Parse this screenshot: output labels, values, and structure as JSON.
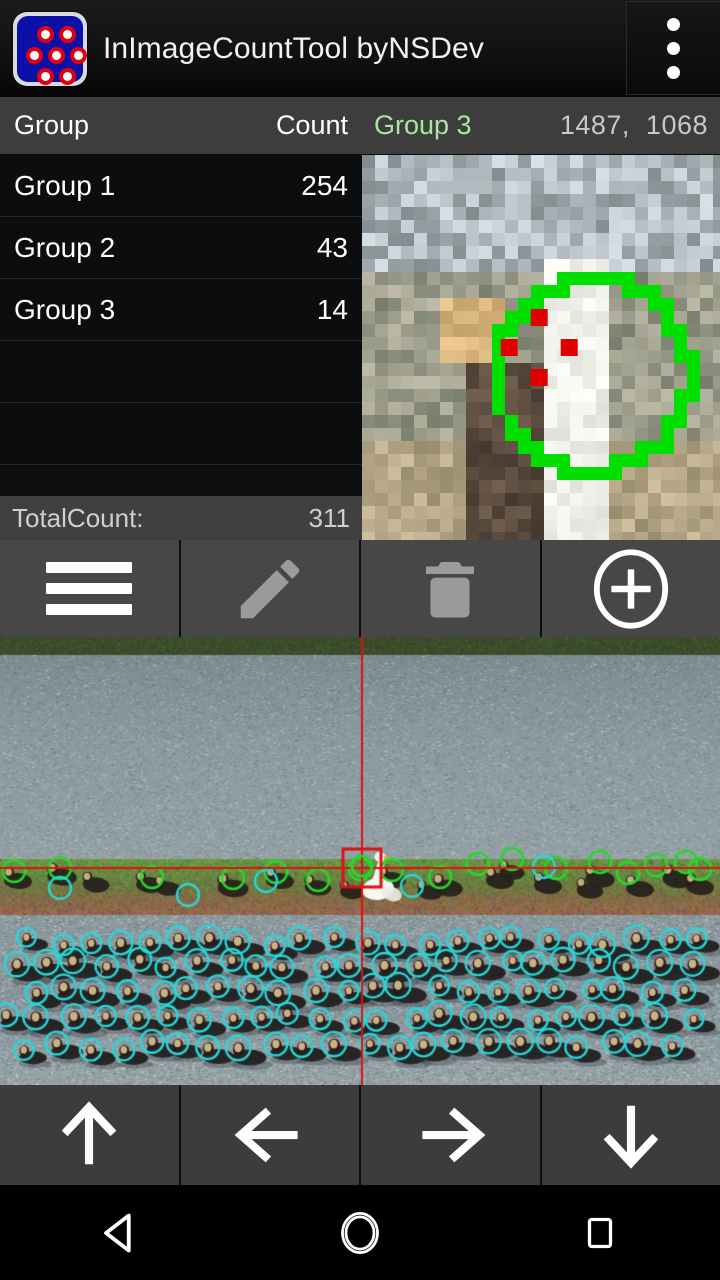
{
  "titlebar": {
    "app_title": "InImageCountTool byNSDev",
    "icon_name": "app-logo-icon",
    "overflow_label": "overflow-menu"
  },
  "table": {
    "headers": {
      "group": "Group",
      "count": "Count"
    },
    "rows": [
      {
        "name": "Group 1",
        "count": "254"
      },
      {
        "name": "Group 2",
        "count": "43"
      },
      {
        "name": "Group 3",
        "count": "14"
      }
    ],
    "empty_rows": 2,
    "total": {
      "label": "TotalCount:",
      "value": "311"
    }
  },
  "zoom_panel": {
    "active_group": "Group 3",
    "coord_x": "1487",
    "separator": ",",
    "coord_y": "1068",
    "marker_color": "#00e000",
    "point_color": "#e00000"
  },
  "toolbar": {
    "buttons": [
      {
        "name": "menu-button",
        "icon": "hamburger-icon",
        "enabled": true
      },
      {
        "name": "edit-button",
        "icon": "pencil-icon",
        "enabled": false
      },
      {
        "name": "delete-button",
        "icon": "trash-icon",
        "enabled": false
      },
      {
        "name": "add-button",
        "icon": "plus-circle-icon",
        "enabled": true
      }
    ]
  },
  "arrowbar": {
    "buttons": [
      {
        "name": "pan-up-button",
        "icon": "arrow-up-icon"
      },
      {
        "name": "pan-left-button",
        "icon": "arrow-left-icon"
      },
      {
        "name": "pan-right-button",
        "icon": "arrow-right-icon"
      },
      {
        "name": "pan-down-button",
        "icon": "arrow-down-icon"
      }
    ]
  },
  "navbar": {
    "buttons": [
      {
        "name": "android-back-button",
        "icon": "triangle-back-icon"
      },
      {
        "name": "android-home-button",
        "icon": "circle-home-icon"
      },
      {
        "name": "android-recents-button",
        "icon": "square-recents-icon"
      }
    ]
  },
  "colors": {
    "group1_marker": "#24d9d9",
    "group2_marker": "#24d92b",
    "crosshair": "#e01010",
    "accent_green": "#a8e6a0",
    "toolbar_bg": "#474747",
    "panel_header_bg": "#3d3d3d",
    "list_bg": "#0c0d0f"
  },
  "crosshair": {
    "x": "362",
    "y": "868",
    "box_size": "38"
  }
}
